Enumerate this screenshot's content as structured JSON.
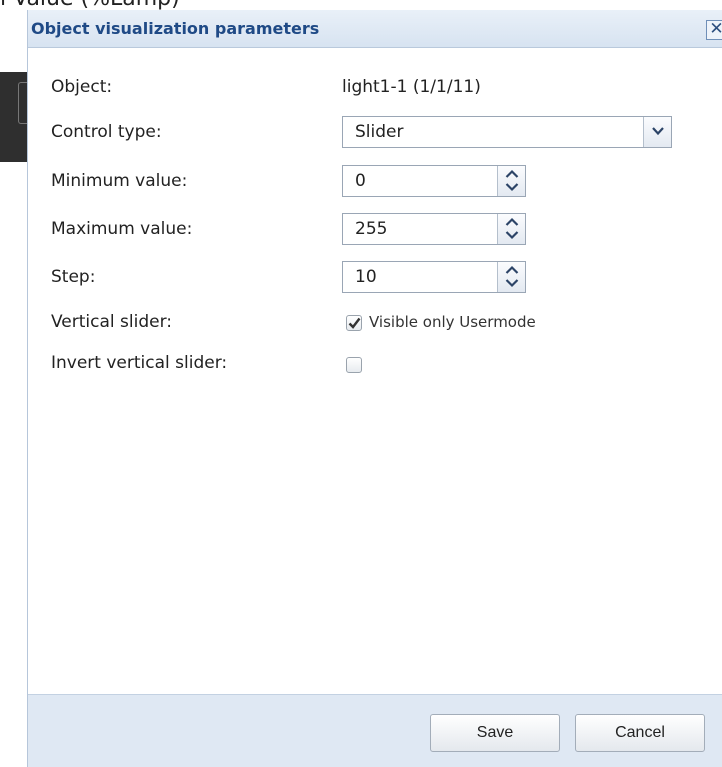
{
  "background": {
    "cut_text": "l Value (%Lamp)"
  },
  "dialog": {
    "title": "Object visualization parameters",
    "close_symbol": "✕"
  },
  "form": {
    "object": {
      "label": "Object:",
      "value": "light1-1 (1/1/11)"
    },
    "control_type": {
      "label": "Control type:",
      "value": "Slider"
    },
    "minimum_value": {
      "label": "Minimum value:",
      "value": "0"
    },
    "maximum_value": {
      "label": "Maximum value:",
      "value": "255"
    },
    "step": {
      "label": "Step:",
      "value": "10"
    },
    "vertical_slider": {
      "label": "Vertical slider:",
      "checked": true,
      "checkbox_text": "Visible only Usermode"
    },
    "invert_vertical_slider": {
      "label": "Invert vertical slider:",
      "checked": false
    }
  },
  "footer": {
    "save_label": "Save",
    "cancel_label": "Cancel"
  },
  "colors": {
    "title_text": "#1f4a86",
    "titlebar_bg": "#dde7f3",
    "footer_bg": "#dfe8f3"
  }
}
